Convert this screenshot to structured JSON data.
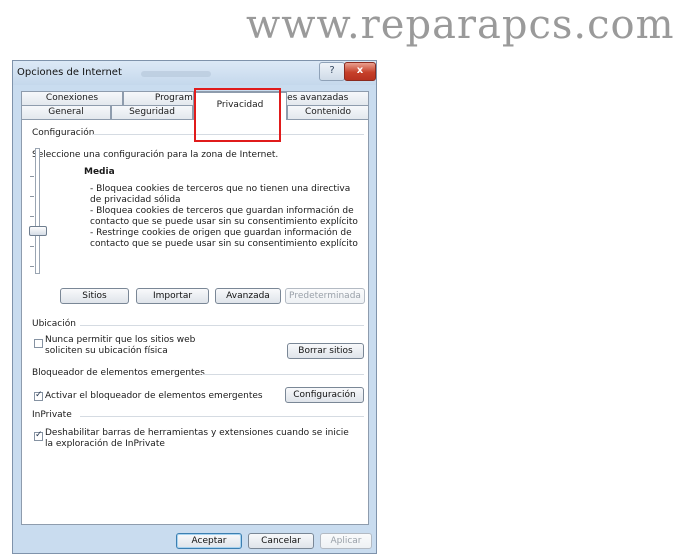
{
  "watermark": "www.reparapcs.com",
  "window": {
    "title": "Opciones de Internet",
    "help": "?",
    "close": "x"
  },
  "tabs_row1": [
    {
      "label": "Conexiones"
    },
    {
      "label": "Programas"
    },
    {
      "label": "Opciones avanzadas"
    }
  ],
  "tabs_row2": [
    {
      "label": "General"
    },
    {
      "label": "Seguridad"
    },
    {
      "label": "Privacidad",
      "selected": true
    },
    {
      "label": "Contenido"
    }
  ],
  "config": {
    "heading": "Configuración",
    "instruction": "Seleccione una configuración para la zona de Internet.",
    "level": "Media",
    "bullets": [
      "- Bloquea cookies de terceros que no tienen una directiva de privacidad sólida",
      "- Bloquea cookies de terceros que guardan información de contacto que se puede usar sin su consentimiento explícito",
      "- Restringe cookies de origen que guardan información de contacto que se puede usar sin su consentimiento explícito"
    ],
    "buttons": {
      "sites": "Sitios",
      "import": "Importar",
      "advanced": "Avanzada",
      "default": "Predeterminada"
    }
  },
  "location": {
    "heading": "Ubicación",
    "checkbox_label": "Nunca permitir que los sitios web soliciten su ubicación física",
    "checked": false,
    "clear_button": "Borrar sitios"
  },
  "popup": {
    "heading": "Bloqueador de elementos emergentes",
    "checkbox_label": "Activar el bloqueador de elementos emergentes",
    "checked": true,
    "settings_button": "Configuración"
  },
  "inprivate": {
    "heading": "InPrivate",
    "checkbox_label": "Deshabilitar barras de herramientas y extensiones cuando se inicie la exploración de InPrivate",
    "checked": true
  },
  "footer": {
    "ok": "Aceptar",
    "cancel": "Cancelar",
    "apply": "Aplicar"
  },
  "colors": {
    "highlight": "#e01b1b",
    "window": "#c9dcef"
  }
}
